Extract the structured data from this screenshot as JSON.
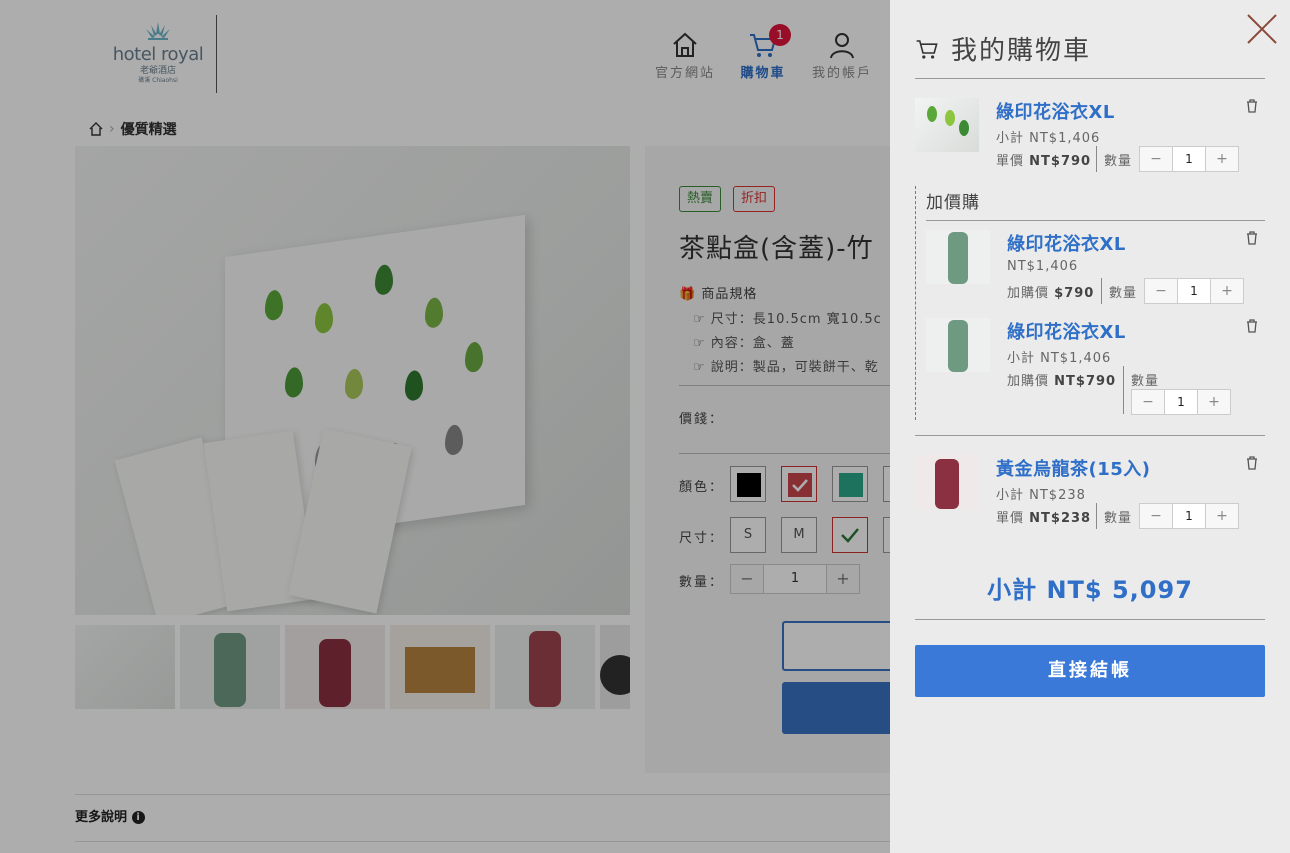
{
  "header": {
    "logo": {
      "brand": "hotel royal",
      "sub": "老爺酒店",
      "sub2": "礁溪 Chiaohsi"
    },
    "nav": [
      {
        "label": "官方網站",
        "icon": "home-icon"
      },
      {
        "label": "購物車",
        "icon": "cart-icon",
        "badge": "1",
        "active": true
      },
      {
        "label": "我的帳戶",
        "icon": "user-icon"
      }
    ]
  },
  "breadcrumb": {
    "current": "優質精選"
  },
  "product": {
    "tags": {
      "hot": "熱賣",
      "discount": "折扣"
    },
    "title": "茶點盒(含蓋)-竹",
    "spec_heading": "商品規格",
    "specs": [
      "尺寸：長10.5cm 寬10.5c",
      "內容：盒、蓋",
      "說明：製品，可裝餅干、乾"
    ],
    "price_label": "價錢：",
    "color_label": "顏色：",
    "size_label": "尺寸：",
    "qty_label": "數量：",
    "sizes": [
      "S",
      "M"
    ],
    "qty": "1",
    "qty_minus": "−",
    "qty_plus": "+"
  },
  "more_info": "更多說明",
  "cart": {
    "title": "我的購物車",
    "qty_label": "數量",
    "minus": "−",
    "plus": "+",
    "items": [
      {
        "name": "綠印花浴衣XL",
        "subtotal": "小計 NT$1,406",
        "unit_label": "單價",
        "unit_price": "NT$790",
        "qty": "1"
      }
    ],
    "addon_title": "加價購",
    "addons": [
      {
        "name": "綠印花浴衣XL",
        "price": "NT$1,406",
        "addon_label": "加購價",
        "addon_price": "$790",
        "qty": "1"
      },
      {
        "name": "綠印花浴衣XL",
        "price": "小計 NT$1,406",
        "addon_label": "加購價",
        "addon_price": "NT$790",
        "qty": "1"
      }
    ],
    "items2": [
      {
        "name": "黃金烏龍茶(15入)",
        "subtotal": "小計 NT$238",
        "unit_label": "單價",
        "unit_price": "NT$238",
        "qty": "1"
      }
    ],
    "total": "小計 NT$ 5,097",
    "checkout": "直接結帳"
  },
  "colors": {
    "accent": "#2f6fc8",
    "button": "#3a79d8",
    "badge": "#e0143c"
  }
}
